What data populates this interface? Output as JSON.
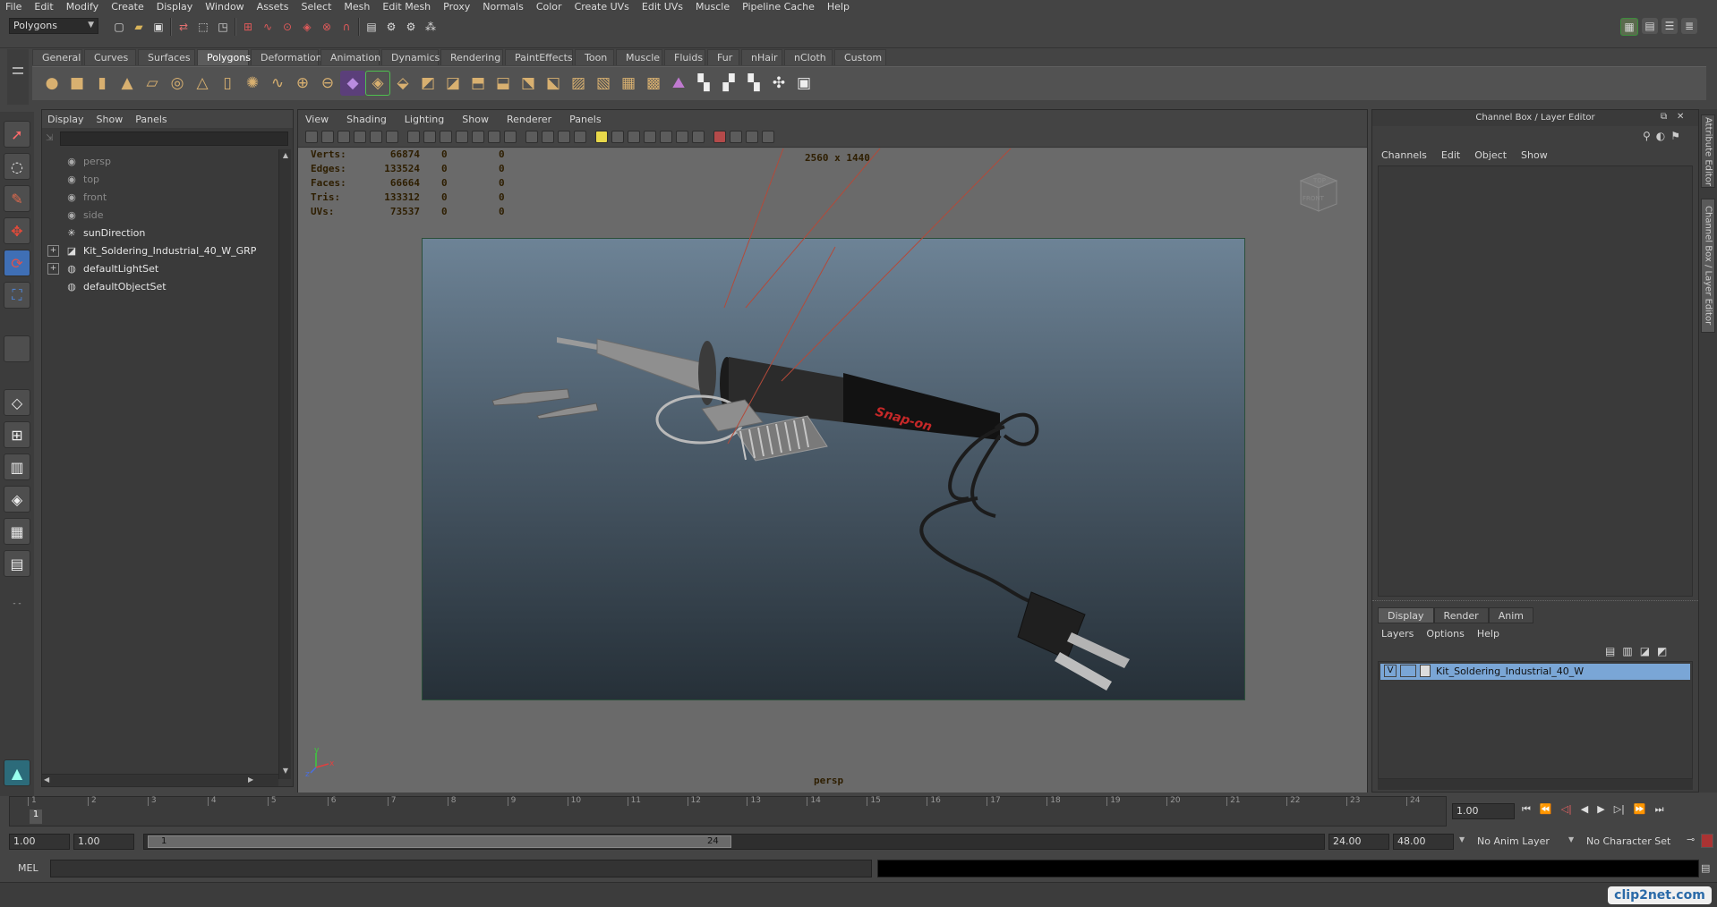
{
  "menubar": [
    "File",
    "Edit",
    "Modify",
    "Create",
    "Display",
    "Window",
    "Assets",
    "Select",
    "Mesh",
    "Edit Mesh",
    "Proxy",
    "Normals",
    "Color",
    "Create UVs",
    "Edit UVs",
    "Muscle",
    "Pipeline Cache",
    "Help"
  ],
  "status_line": {
    "mode": "Polygons"
  },
  "shelf": {
    "tabs": [
      "General",
      "Curves",
      "Surfaces",
      "Polygons",
      "Deformation",
      "Animation",
      "Dynamics",
      "Rendering",
      "PaintEffects",
      "Toon",
      "Muscle",
      "Fluids",
      "Fur",
      "nHair",
      "nCloth",
      "Custom"
    ],
    "active_tab": "Polygons"
  },
  "outliner": {
    "menu": [
      "Display",
      "Show",
      "Panels"
    ],
    "items": [
      {
        "label": "persp",
        "icon": "camera-icon",
        "dim": true,
        "expandable": false
      },
      {
        "label": "top",
        "icon": "camera-icon",
        "dim": true,
        "expandable": false
      },
      {
        "label": "front",
        "icon": "camera-icon",
        "dim": true,
        "expandable": false
      },
      {
        "label": "side",
        "icon": "camera-icon",
        "dim": true,
        "expandable": false
      },
      {
        "label": "sunDirection",
        "icon": "light-icon",
        "dim": false,
        "expandable": false
      },
      {
        "label": "Kit_Soldering_Industrial_40_W_GRP",
        "icon": "group-icon",
        "dim": false,
        "expandable": true
      },
      {
        "label": "defaultLightSet",
        "icon": "set-icon",
        "dim": false,
        "expandable": true
      },
      {
        "label": "defaultObjectSet",
        "icon": "set-icon",
        "dim": false,
        "expandable": false
      }
    ]
  },
  "viewport": {
    "menu": [
      "View",
      "Shading",
      "Lighting",
      "Show",
      "Renderer",
      "Panels"
    ],
    "resolution": "2560 x 1440",
    "camera": "persp",
    "view_cube": {
      "top": "TOP",
      "front": "FRONT"
    },
    "stats": [
      {
        "label": "Verts:",
        "v1": "66874",
        "v2": "0",
        "v3": "0"
      },
      {
        "label": "Edges:",
        "v1": "133524",
        "v2": "0",
        "v3": "0"
      },
      {
        "label": "Faces:",
        "v1": "66664",
        "v2": "0",
        "v3": "0"
      },
      {
        "label": "Tris:",
        "v1": "133312",
        "v2": "0",
        "v3": "0"
      },
      {
        "label": "UVs:",
        "v1": "73537",
        "v2": "0",
        "v3": "0"
      }
    ],
    "product_logo": "Snap-on",
    "axis": {
      "x": "x",
      "y": "y",
      "z": "z"
    }
  },
  "channel_box": {
    "title": "Channel Box / Layer Editor",
    "menu": [
      "Channels",
      "Edit",
      "Object",
      "Show"
    ],
    "layer_tabs": [
      "Display",
      "Render",
      "Anim"
    ],
    "active_layer_tab": "Display",
    "layer_menu": [
      "Layers",
      "Options",
      "Help"
    ],
    "layers": [
      {
        "visible": "V",
        "name": "Kit_Soldering_Industrial_40_W"
      }
    ]
  },
  "side_tabs": [
    "Attribute Editor",
    "Channel Box / Layer Editor"
  ],
  "time_slider": {
    "ticks": [
      "1",
      "2",
      "3",
      "4",
      "5",
      "6",
      "7",
      "8",
      "9",
      "10",
      "11",
      "12",
      "13",
      "14",
      "15",
      "16",
      "17",
      "18",
      "19",
      "20",
      "21",
      "22",
      "23",
      "24"
    ],
    "current_frame_marker": "1",
    "current_time": "1.00"
  },
  "range": {
    "start_time": "1.00",
    "playback_start": "1.00",
    "slider_start": "1",
    "slider_end": "24",
    "playback_end": "24.00",
    "end_time": "48.00",
    "anim_layer": "No Anim Layer",
    "character_set": "No Character Set"
  },
  "command_line": {
    "label": "MEL"
  },
  "watermark": "clip2net.com",
  "colors": {
    "accent": "#5d8dbb",
    "active_layer": "#7aa6d6",
    "viewport_top": "#6d8396",
    "viewport_bottom": "#263038",
    "hud_text": "#2e1e00"
  }
}
